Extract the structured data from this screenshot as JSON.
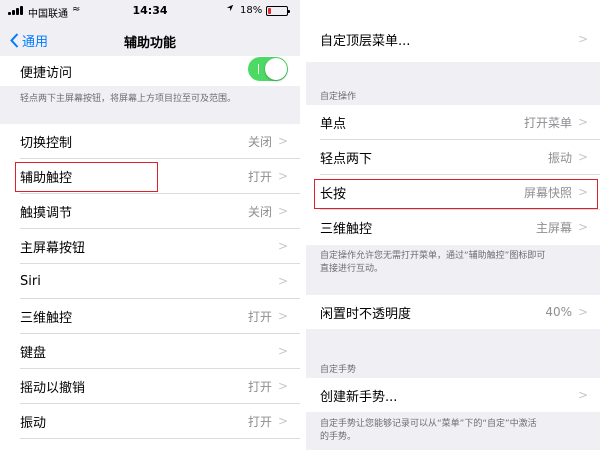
{
  "status_bar": {
    "carrier": "中国联通",
    "wifi": "≈",
    "time": "14:34",
    "location_icon": "location-arrow-icon",
    "battery_text": "18%",
    "battery_level": 0.18,
    "battery_color": "#e3272d"
  },
  "nav": {
    "back_label": "通用",
    "title": "辅助功能"
  },
  "left": {
    "top_row": {
      "label": "便捷访问",
      "toggle_on": true
    },
    "top_note": "轻点两下主屏幕按钮，将屏幕上方项目拉至可及范围。",
    "rows": [
      {
        "label": "切换控制",
        "value": "关闭"
      },
      {
        "label": "辅助触控",
        "value": "打开"
      },
      {
        "label": "触摸调节",
        "value": "关闭"
      },
      {
        "label": "主屏幕按钮",
        "value": ""
      },
      {
        "label": "Siri",
        "value": ""
      },
      {
        "label": "三维触控",
        "value": "打开"
      },
      {
        "label": "键盘",
        "value": ""
      },
      {
        "label": "摇动以撤销",
        "value": "打开"
      },
      {
        "label": "振动",
        "value": "打开"
      }
    ]
  },
  "right": {
    "top_menu": {
      "label": "自定顶层菜单..."
    },
    "custom_actions_header": "自定操作",
    "actions": [
      {
        "label": "单点",
        "value": "打开菜单"
      },
      {
        "label": "轻点两下",
        "value": "振动"
      },
      {
        "label": "长按",
        "value": "屏幕快照"
      },
      {
        "label": "三维触控",
        "value": "主屏幕"
      }
    ],
    "actions_note_line1": "自定操作允许您无需打开菜单，通过“辅助触控”图标即可",
    "actions_note_line2": "直接进行互动。",
    "opacity": {
      "label": "闲置时不透明度",
      "value": "40%"
    },
    "gestures_header": "自定手势",
    "new_gesture": {
      "label": "创建新手势..."
    },
    "gestures_note_line1": "自定手势让您能够记录可以从“菜单”下的“自定”中激活",
    "gestures_note_line2": "的手势。"
  },
  "colors": {
    "accent": "#007aff",
    "toggle_on": "#4cd964",
    "highlight_box": "#d9222a",
    "background": "#efeff4"
  }
}
